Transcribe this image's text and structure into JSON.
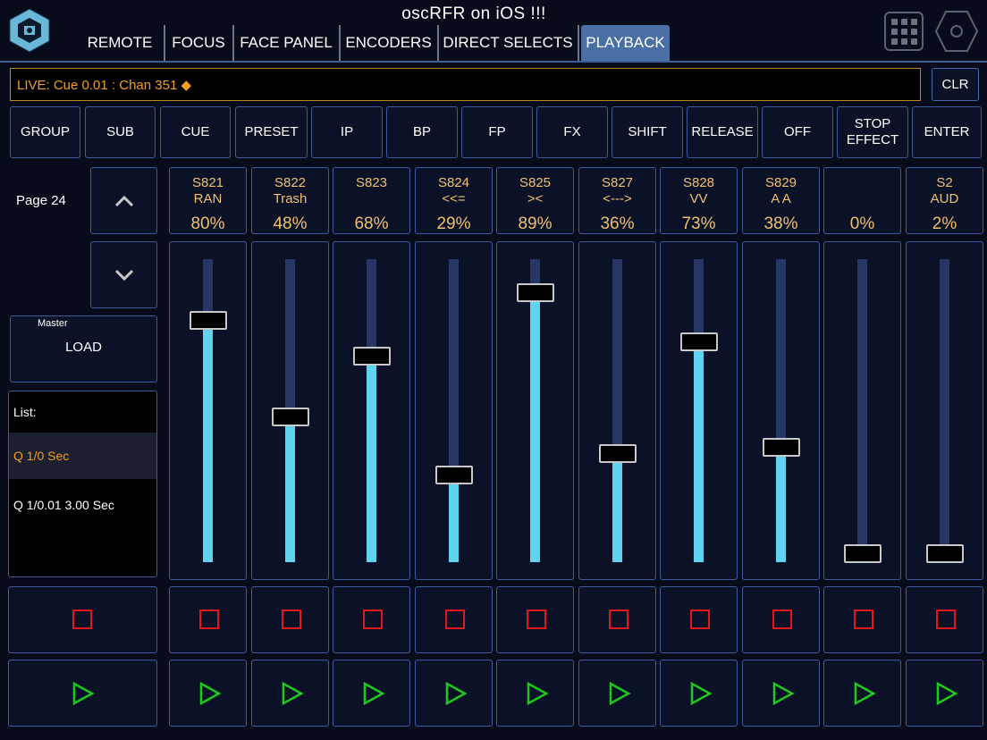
{
  "app": {
    "title": "oscRFR  on  iOS !!!"
  },
  "tabs": [
    {
      "label": "REMOTE"
    },
    {
      "label": "FOCUS"
    },
    {
      "label": "FACE PANEL"
    },
    {
      "label": "ENCODERS"
    },
    {
      "label": "DIRECT SELECTS"
    },
    {
      "label": "PLAYBACK",
      "active": true
    }
  ],
  "command_line": {
    "text": "LIVE: Cue  0.01 : Chan 351 ◆"
  },
  "clear_button": {
    "label": "CLR"
  },
  "keys": [
    {
      "label": "GROUP"
    },
    {
      "label": "SUB"
    },
    {
      "label": "CUE"
    },
    {
      "label": "PRESET"
    },
    {
      "label": "IP"
    },
    {
      "label": "BP"
    },
    {
      "label": "FP"
    },
    {
      "label": "FX"
    },
    {
      "label": "SHIFT"
    },
    {
      "label": "RELEASE"
    },
    {
      "label": "OFF"
    },
    {
      "label": "STOP\nEFFECT"
    },
    {
      "label": "ENTER"
    }
  ],
  "page": {
    "label": "Page  24"
  },
  "master": {
    "title": "Master",
    "label": "LOAD"
  },
  "cue_list": {
    "header": "List:",
    "items": [
      {
        "text": "Q  1/0 Sec",
        "selected": true
      },
      {
        "text": "Q  1/0.01 3.00 Sec",
        "selected": false
      }
    ]
  },
  "submasters": [
    {
      "number": "S821",
      "label": "RAN",
      "percent_text": "80%",
      "level": 0.8
    },
    {
      "number": "S822",
      "label": "Trash",
      "percent_text": "48%",
      "level": 0.48
    },
    {
      "number": "S823",
      "label": "",
      "percent_text": "68%",
      "level": 0.68
    },
    {
      "number": "S824",
      "label": "<<=",
      "percent_text": "29%",
      "level": 0.29
    },
    {
      "number": "S825",
      "label": "><",
      "percent_text": "89%",
      "level": 0.89
    },
    {
      "number": "S827",
      "label": "<--->",
      "percent_text": "36%",
      "level": 0.36
    },
    {
      "number": "S828",
      "label": "VV",
      "percent_text": "73%",
      "level": 0.73
    },
    {
      "number": "S829",
      "label": "A A",
      "percent_text": "38%",
      "level": 0.38
    },
    {
      "number": "",
      "label": "",
      "percent_text": "0%",
      "level": 0.0
    },
    {
      "number": "S2",
      "label": "AUD",
      "percent_text": "2%",
      "level": 0.02
    }
  ],
  "colors": {
    "accent": "#4a6fa5",
    "fader_fill": "#5fd3f0",
    "stop": "#e0181c",
    "play": "#1ec81e",
    "command_text": "#f0a020",
    "sub_text": "#f0c070"
  }
}
